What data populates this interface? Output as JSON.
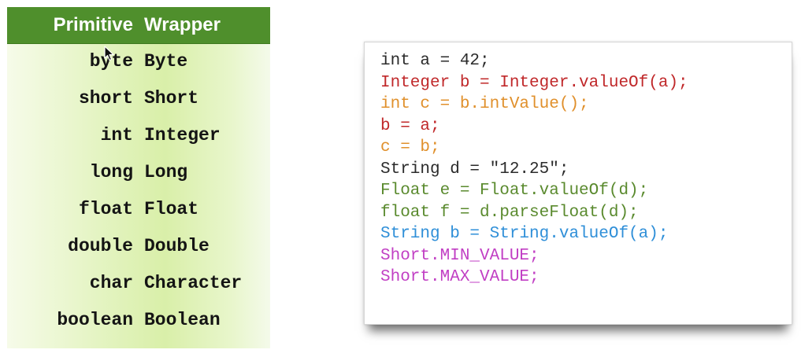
{
  "table": {
    "header": {
      "primitive": "Primitive",
      "wrapper": "Wrapper"
    },
    "rows": [
      {
        "primitive": "byte",
        "wrapper": "Byte"
      },
      {
        "primitive": "short",
        "wrapper": "Short"
      },
      {
        "primitive": "int",
        "wrapper": "Integer"
      },
      {
        "primitive": "long",
        "wrapper": "Long"
      },
      {
        "primitive": "float",
        "wrapper": "Float"
      },
      {
        "primitive": "double",
        "wrapper": "Double"
      },
      {
        "primitive": "char",
        "wrapper": "Character"
      },
      {
        "primitive": "boolean",
        "wrapper": "Boolean"
      }
    ]
  },
  "code": {
    "lines": [
      {
        "text": "int a = 42;",
        "color": "#2b2b2b"
      },
      {
        "text": "Integer b = Integer.valueOf(a);",
        "color": "#c0282a"
      },
      {
        "text": "int c = b.intValue();",
        "color": "#e0902c"
      },
      {
        "text": "b = a;",
        "color": "#c0282a"
      },
      {
        "text": "c = b;",
        "color": "#e0902c"
      },
      {
        "text": "String d = \"12.25\";",
        "color": "#2b2b2b"
      },
      {
        "text": "Float e = Float.valueOf(d);",
        "color": "#5a8a2e"
      },
      {
        "text": "float f = d.parseFloat(d);",
        "color": "#5a8a2e"
      },
      {
        "text": "String b = String.valueOf(a);",
        "color": "#2f8fd8"
      },
      {
        "text": "Short.MIN_VALUE;",
        "color": "#c13fc4"
      },
      {
        "text": "Short.MAX_VALUE;",
        "color": "#c13fc4"
      }
    ]
  },
  "icons": {
    "cursor": "mouse-pointer-icon"
  }
}
